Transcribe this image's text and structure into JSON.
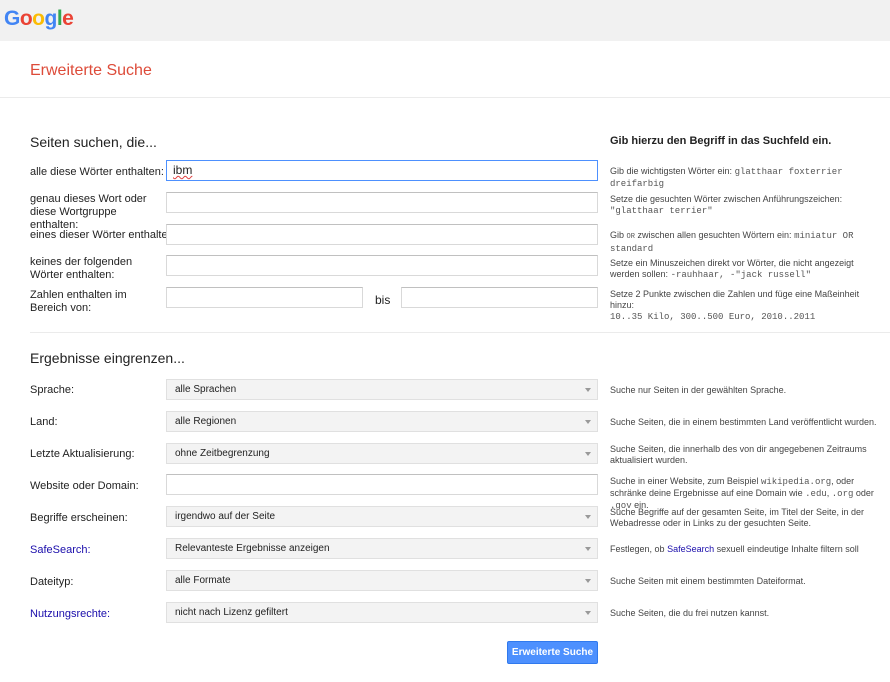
{
  "logo": {
    "letters": [
      "G",
      "o",
      "o",
      "g",
      "l",
      "e"
    ],
    "colors": [
      "#4285f4",
      "#ea4335",
      "#fbbc05",
      "#4285f4",
      "#34a853",
      "#ea4335"
    ]
  },
  "page_title": "Erweiterte Suche",
  "search_section": {
    "heading": "Seiten suchen, die...",
    "hint_heading": "Gib hierzu den Begriff in das Suchfeld ein.",
    "all_words": {
      "label": "alle diese Wörter enthalten:",
      "value": "ibm",
      "hint_prefix": "Gib die wichtigsten Wörter ein:",
      "hint_code": "glatthaar foxterrier dreifarbig"
    },
    "exact_phrase": {
      "label": "genau dieses Wort oder diese Wortgruppe enthalten:",
      "value": "",
      "hint_prefix": "Setze die gesuchten Wörter zwischen Anführungszeichen:",
      "hint_code": "\"glatthaar terrier\""
    },
    "any_words": {
      "label": "eines dieser Wörter enthalten:",
      "value": "",
      "hint_prefix": "Gib",
      "hint_or": "OR",
      "hint_middle": "zwischen allen gesuchten Wörtern ein:",
      "hint_code": "miniatur OR standard"
    },
    "none_words": {
      "label": "keines der folgenden Wörter enthalten:",
      "value": "",
      "hint_prefix": "Setze ein Minuszeichen direkt vor Wörter, die nicht angezeigt werden sollen:",
      "hint_code": "-rauhhaar, -\"jack russell\""
    },
    "number_range": {
      "label": "Zahlen enthalten im Bereich von:",
      "from": "",
      "bis_label": "bis",
      "to": "",
      "hint_prefix": "Setze 2 Punkte zwischen die Zahlen und füge eine Maßeinheit hinzu:",
      "hint_code": "10..35 Kilo, 300..500 Euro, 2010..2011"
    }
  },
  "narrow_section": {
    "heading": "Ergebnisse eingrenzen...",
    "language": {
      "label": "Sprache:",
      "selected": "alle Sprachen",
      "hint": "Suche nur Seiten in der gewählten Sprache."
    },
    "region": {
      "label": "Land:",
      "selected": "alle Regionen",
      "hint": "Suche Seiten, die in einem bestimmten Land veröffentlicht wurden."
    },
    "last_update": {
      "label": "Letzte Aktualisierung:",
      "selected": "ohne Zeitbegrenzung",
      "hint": "Suche Seiten, die innerhalb des von dir angegebenen Zeitraums aktualisiert wurden."
    },
    "site": {
      "label": "Website oder Domain:",
      "value": "",
      "hint_a": "Suche in einer Website, zum Beispiel",
      "hint_code1": "wikipedia.org",
      "hint_b": ", oder schränke deine Ergebnisse auf eine Domain wie",
      "hint_code2": ".edu",
      "hint_c": ",",
      "hint_code3": ".org",
      "hint_d": "oder",
      "hint_code4": ".gov",
      "hint_e": "ein."
    },
    "terms_appear": {
      "label": "Begriffe erscheinen:",
      "selected": "irgendwo auf der Seite",
      "hint": "Suche Begriffe auf der gesamten Seite, im Titel der Seite, in der Webadresse oder in Links zu der gesuchten Seite."
    },
    "safesearch": {
      "label": "SafeSearch:",
      "selected": "Relevanteste Ergebnisse anzeigen",
      "hint_a": "Festlegen, ob",
      "hint_link": "SafeSearch",
      "hint_b": "sexuell eindeutige Inhalte filtern soll"
    },
    "file_type": {
      "label": "Dateityp:",
      "selected": "alle Formate",
      "hint": "Suche Seiten mit einem bestimmten Dateiformat."
    },
    "usage_rights": {
      "label": "Nutzungsrechte:",
      "selected": "nicht nach Lizenz gefiltert",
      "hint": "Suche Seiten, die du frei nutzen kannst."
    }
  },
  "submit_label": "Erweiterte Suche",
  "colors": {
    "title": "#dd4b39",
    "link": "#1a0dab",
    "button": "#4d90fe",
    "focus_border": "#4d90fe"
  }
}
